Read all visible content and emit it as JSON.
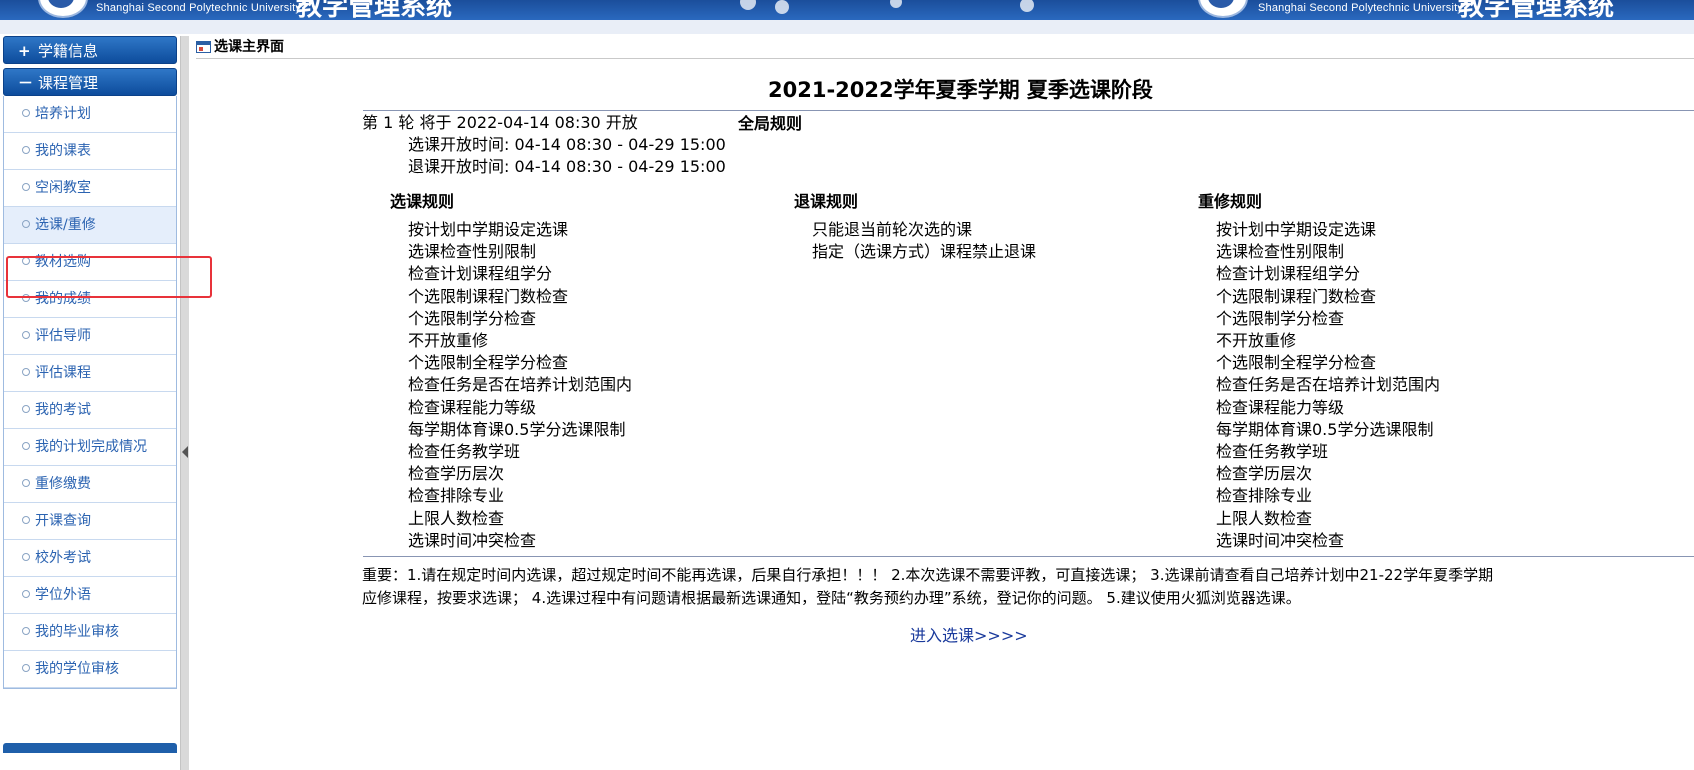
{
  "banner": {
    "school_en_left": "Shanghai Second Polytechnic University",
    "school_en_right": "Shanghai Second Polytechnic University",
    "system_title_left": "教学管理系统",
    "system_title_right": "教学管理系统"
  },
  "sidebar": {
    "sections": [
      {
        "sign": "+",
        "label": "学籍信息"
      },
      {
        "sign": "－",
        "label": "课程管理"
      }
    ],
    "items": [
      {
        "label": "培养计划"
      },
      {
        "label": "我的课表"
      },
      {
        "label": "空闲教室"
      },
      {
        "label": "选课/重修",
        "active": true
      },
      {
        "label": "教材选购"
      },
      {
        "label": "我的成绩"
      },
      {
        "label": "评估导师"
      },
      {
        "label": "评估课程"
      },
      {
        "label": "我的考试"
      },
      {
        "label": "我的计划完成情况"
      },
      {
        "label": "重修缴费"
      },
      {
        "label": "开课查询"
      },
      {
        "label": "校外考试"
      },
      {
        "label": "学位外语"
      },
      {
        "label": "我的毕业审核"
      },
      {
        "label": "我的学位审核"
      }
    ]
  },
  "main": {
    "page_title": "选课主界面",
    "term_title": "2021-2022学年夏季学期 夏季选课阶段",
    "round": {
      "line": "第 1 轮 将于 2022-04-14 08:30 开放",
      "select_time": "选课开放时间: 04-14 08:30 - 04-29 15:00",
      "withdraw_time": "退课开放时间: 04-14 08:30 - 04-29 15:00"
    },
    "global_rules_heading": "全局规则",
    "select_rules": {
      "heading": "选课规则",
      "items": [
        "按计划中学期设定选课",
        "选课检查性别限制",
        "检查计划课程组学分",
        "个选限制课程门数检查",
        "个选限制学分检查",
        "不开放重修",
        "个选限制全程学分检查",
        "检查任务是否在培养计划范围内",
        "检查课程能力等级",
        "每学期体育课0.5学分选课限制",
        "检查任务教学班",
        "检查学历层次",
        "检查排除专业",
        "上限人数检查",
        "选课时间冲突检查"
      ]
    },
    "withdraw_rules": {
      "heading": "退课规则",
      "items": [
        "只能退当前轮次选的课",
        "指定（选课方式）课程禁止退课"
      ]
    },
    "retake_rules": {
      "heading": "重修规则",
      "items": [
        "按计划中学期设定选课",
        "选课检查性别限制",
        "检查计划课程组学分",
        "个选限制课程门数检查",
        "个选限制学分检查",
        "不开放重修",
        "个选限制全程学分检查",
        "检查任务是否在培养计划范围内",
        "检查课程能力等级",
        "每学期体育课0.5学分选课限制",
        "检查任务教学班",
        "检查学历层次",
        "检查排除专业",
        "上限人数检查",
        "选课时间冲突检查"
      ]
    },
    "notice_line1": "重要：1.请在规定时间内选课，超过规定时间不能再选课，后果自行承担！！！ 2.本次选课不需要评教，可直接选课； 3.选课前请查看自己培养计划中21-22学年夏季学期",
    "notice_line2": "应修课程，按要求选课； 4.选课过程中有问题请根据最新选课通知，登陆“教务预约办理”系统，登记你的问题。 5.建议使用火狐浏览器选课。",
    "enter_link": "进入选课>>>>"
  },
  "colors": {
    "banner_blue": "#1b4e9b",
    "menu_header_blue": "#0d4c9c",
    "menu_link_blue": "#2b63b1",
    "highlight_red": "#e8323a",
    "enter_link_blue": "#1a3a9c"
  }
}
